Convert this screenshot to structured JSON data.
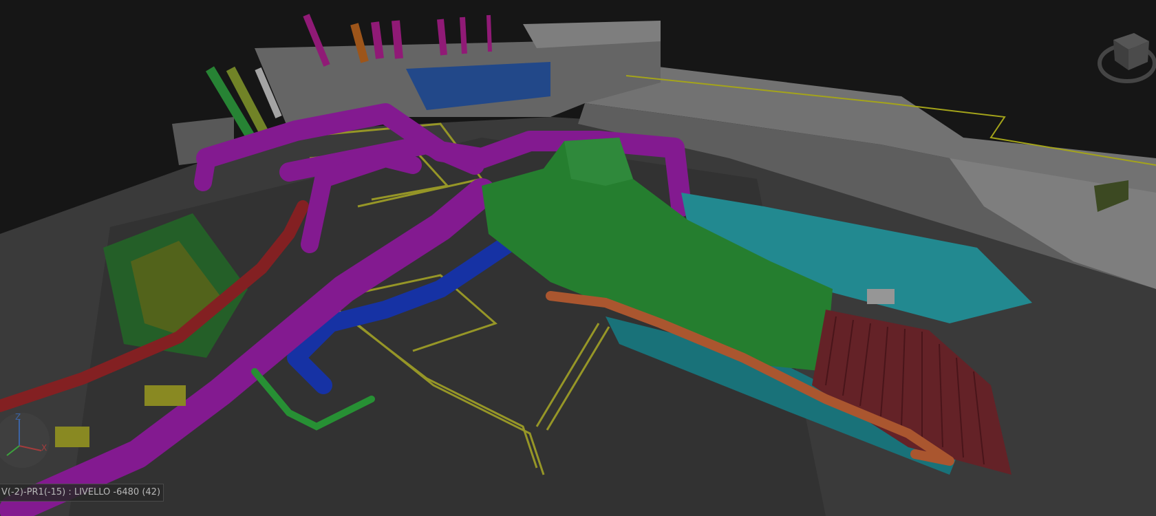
{
  "viewport": {
    "status_text": "V(-2)-PR1(-15) : LIVELLO -6480 (42)",
    "axis_labels": {
      "z": "Z",
      "x": "X"
    },
    "view_cube_icon": "view-cube-icon",
    "axis_triad_icon": "axis-triad-icon"
  },
  "colors": {
    "background": "#1c1c1c",
    "floor": "#4a4a4a",
    "building": "#8a8a8a",
    "magenta_duct": "#a020b0",
    "green_duct": "#2e9a3a",
    "cyan_duct": "#22a0a8",
    "blue_duct": "#1c3ec8",
    "red_pipe": "#b0302a",
    "yellow_pipe": "#b8b830",
    "orange_pipe": "#d06a3a"
  }
}
